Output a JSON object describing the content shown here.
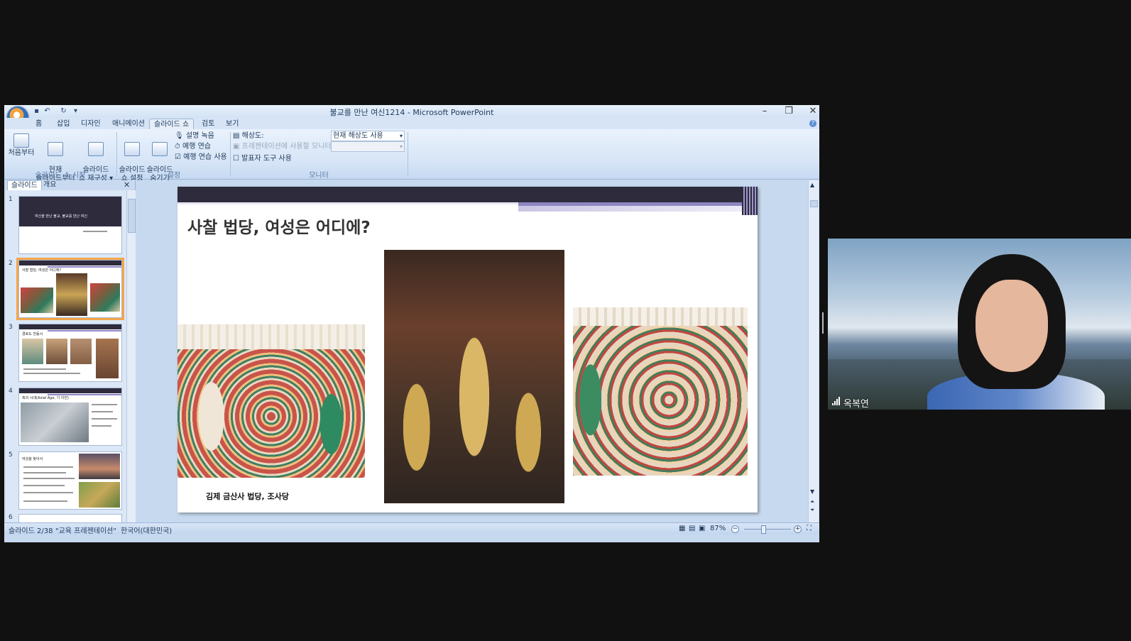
{
  "window": {
    "title": "불교를 만난 여신1214 - Microsoft PowerPoint"
  },
  "ribbon_tabs": [
    "홈",
    "삽입",
    "디자인",
    "애니메이션",
    "슬라이드 쇼",
    "검토",
    "보기"
  ],
  "ribbon": {
    "groups": [
      {
        "label": "슬라이드 쇼 시작",
        "buttons": [
          "처음부터",
          "현재\n슬라이드부터",
          "슬라이드\n쇼 재구성 ▾"
        ]
      },
      {
        "label": "설정",
        "buttons": [
          "슬라이드\n쇼 설정",
          "슬라이드\n숨기기"
        ],
        "small": [
          "설명 녹음",
          "예행 연습",
          "예행 연습 사용"
        ]
      },
      {
        "label": "모니터"
      }
    ],
    "resolution_label": "해상도:",
    "resolution_value": "현재 해상도 사용",
    "monitor_label": "프레젠테이션에 사용할 모니터:",
    "presenter_tools": "발표자 도구 사용"
  },
  "leftpane": {
    "tabs": [
      "슬라이드",
      "개요"
    ],
    "thumbs": [
      {
        "num": "1",
        "title": "여신을 만난 불교, 불교를 만난 여신"
      },
      {
        "num": "2",
        "title": "사찰 법당, 여성은 어디에?"
      },
      {
        "num": "3",
        "title": "경로도 전동시"
      },
      {
        "num": "4",
        "title": "축의 시대(Axial Age, 기 이전)"
      },
      {
        "num": "5",
        "title": "여성을 찾아서"
      },
      {
        "num": "6",
        "title": ""
      }
    ]
  },
  "slide": {
    "title": "사찰 법당, 여성은 어디에?",
    "caption": "김제 금산사 법당, 조사당"
  },
  "status": {
    "slide_pos": "슬라이드 2/38",
    "theme": "\"교육 프레젠테이션\"",
    "lang": "한국어(대한민국)",
    "zoom": "87%"
  },
  "webcam": {
    "name": "옥복연"
  },
  "colors": {
    "accent": "#f3a64a",
    "slide_band": "#2e2b3d",
    "stripe": "#8d86c2"
  }
}
